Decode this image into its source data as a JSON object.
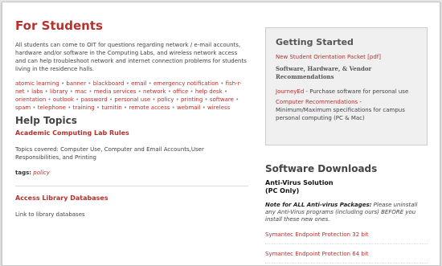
{
  "left": {
    "title": "For Students",
    "intro": "All students can come to OIT for questions regarding network / e-mail accounts, hardware and/or software in the Computing Labs, and wireless network access and can help troubleshoot network and internet connection problems for students living in the residence halls.",
    "tag_links": [
      "atomic learning",
      "banner",
      "blackboard",
      "email",
      "emergency notification",
      "fish-r-net",
      "labs",
      "library",
      "mac",
      "media services",
      "network",
      "office",
      "help desk",
      "orientation",
      "outlook",
      "password",
      "personal use",
      "policy",
      "printing",
      "software",
      "spam",
      "telephone",
      "training",
      "turnitin",
      "remote access",
      "webmail",
      "wireless"
    ],
    "help_topics_heading": "Help Topics",
    "topics": [
      {
        "title": "Academic Computing Lab Rules",
        "desc": "Topics covered: Computer Use, Computer and Email Accounts,User Responsibilities, and Printing",
        "tags_label": "tags:",
        "tag": "policy"
      },
      {
        "title": "Access Library Databases",
        "desc": "Link to library databases"
      }
    ]
  },
  "right": {
    "getting_started": {
      "title": "Getting Started",
      "orientation_link": "New Student Orientation Packet [pdf]",
      "recommendations_heading": "Software, Hardware, & Vendor Recommendations",
      "journeyed_link": "JourneyEd",
      "journeyed_text": " - Purchase software for personal use",
      "computer_rec_link": "Computer Recommendations",
      "computer_rec_text": " - Minimum/Maximum specifications for campus personal computing (PC & Mac)"
    },
    "downloads": {
      "title": "Software Downloads",
      "av_title": "Anti-Virus Solution",
      "av_sub": "(PC Only)",
      "note_bold": "Note for ALL Anti-virus Packages:",
      "note_text": " Please uninstall any Anti-Virus programs (including ours) BEFORE you install these new ones.",
      "links": [
        "Symantec Endpoint Protection 32 bit",
        "Symantec Endpoint Protection 64 bit"
      ]
    }
  }
}
